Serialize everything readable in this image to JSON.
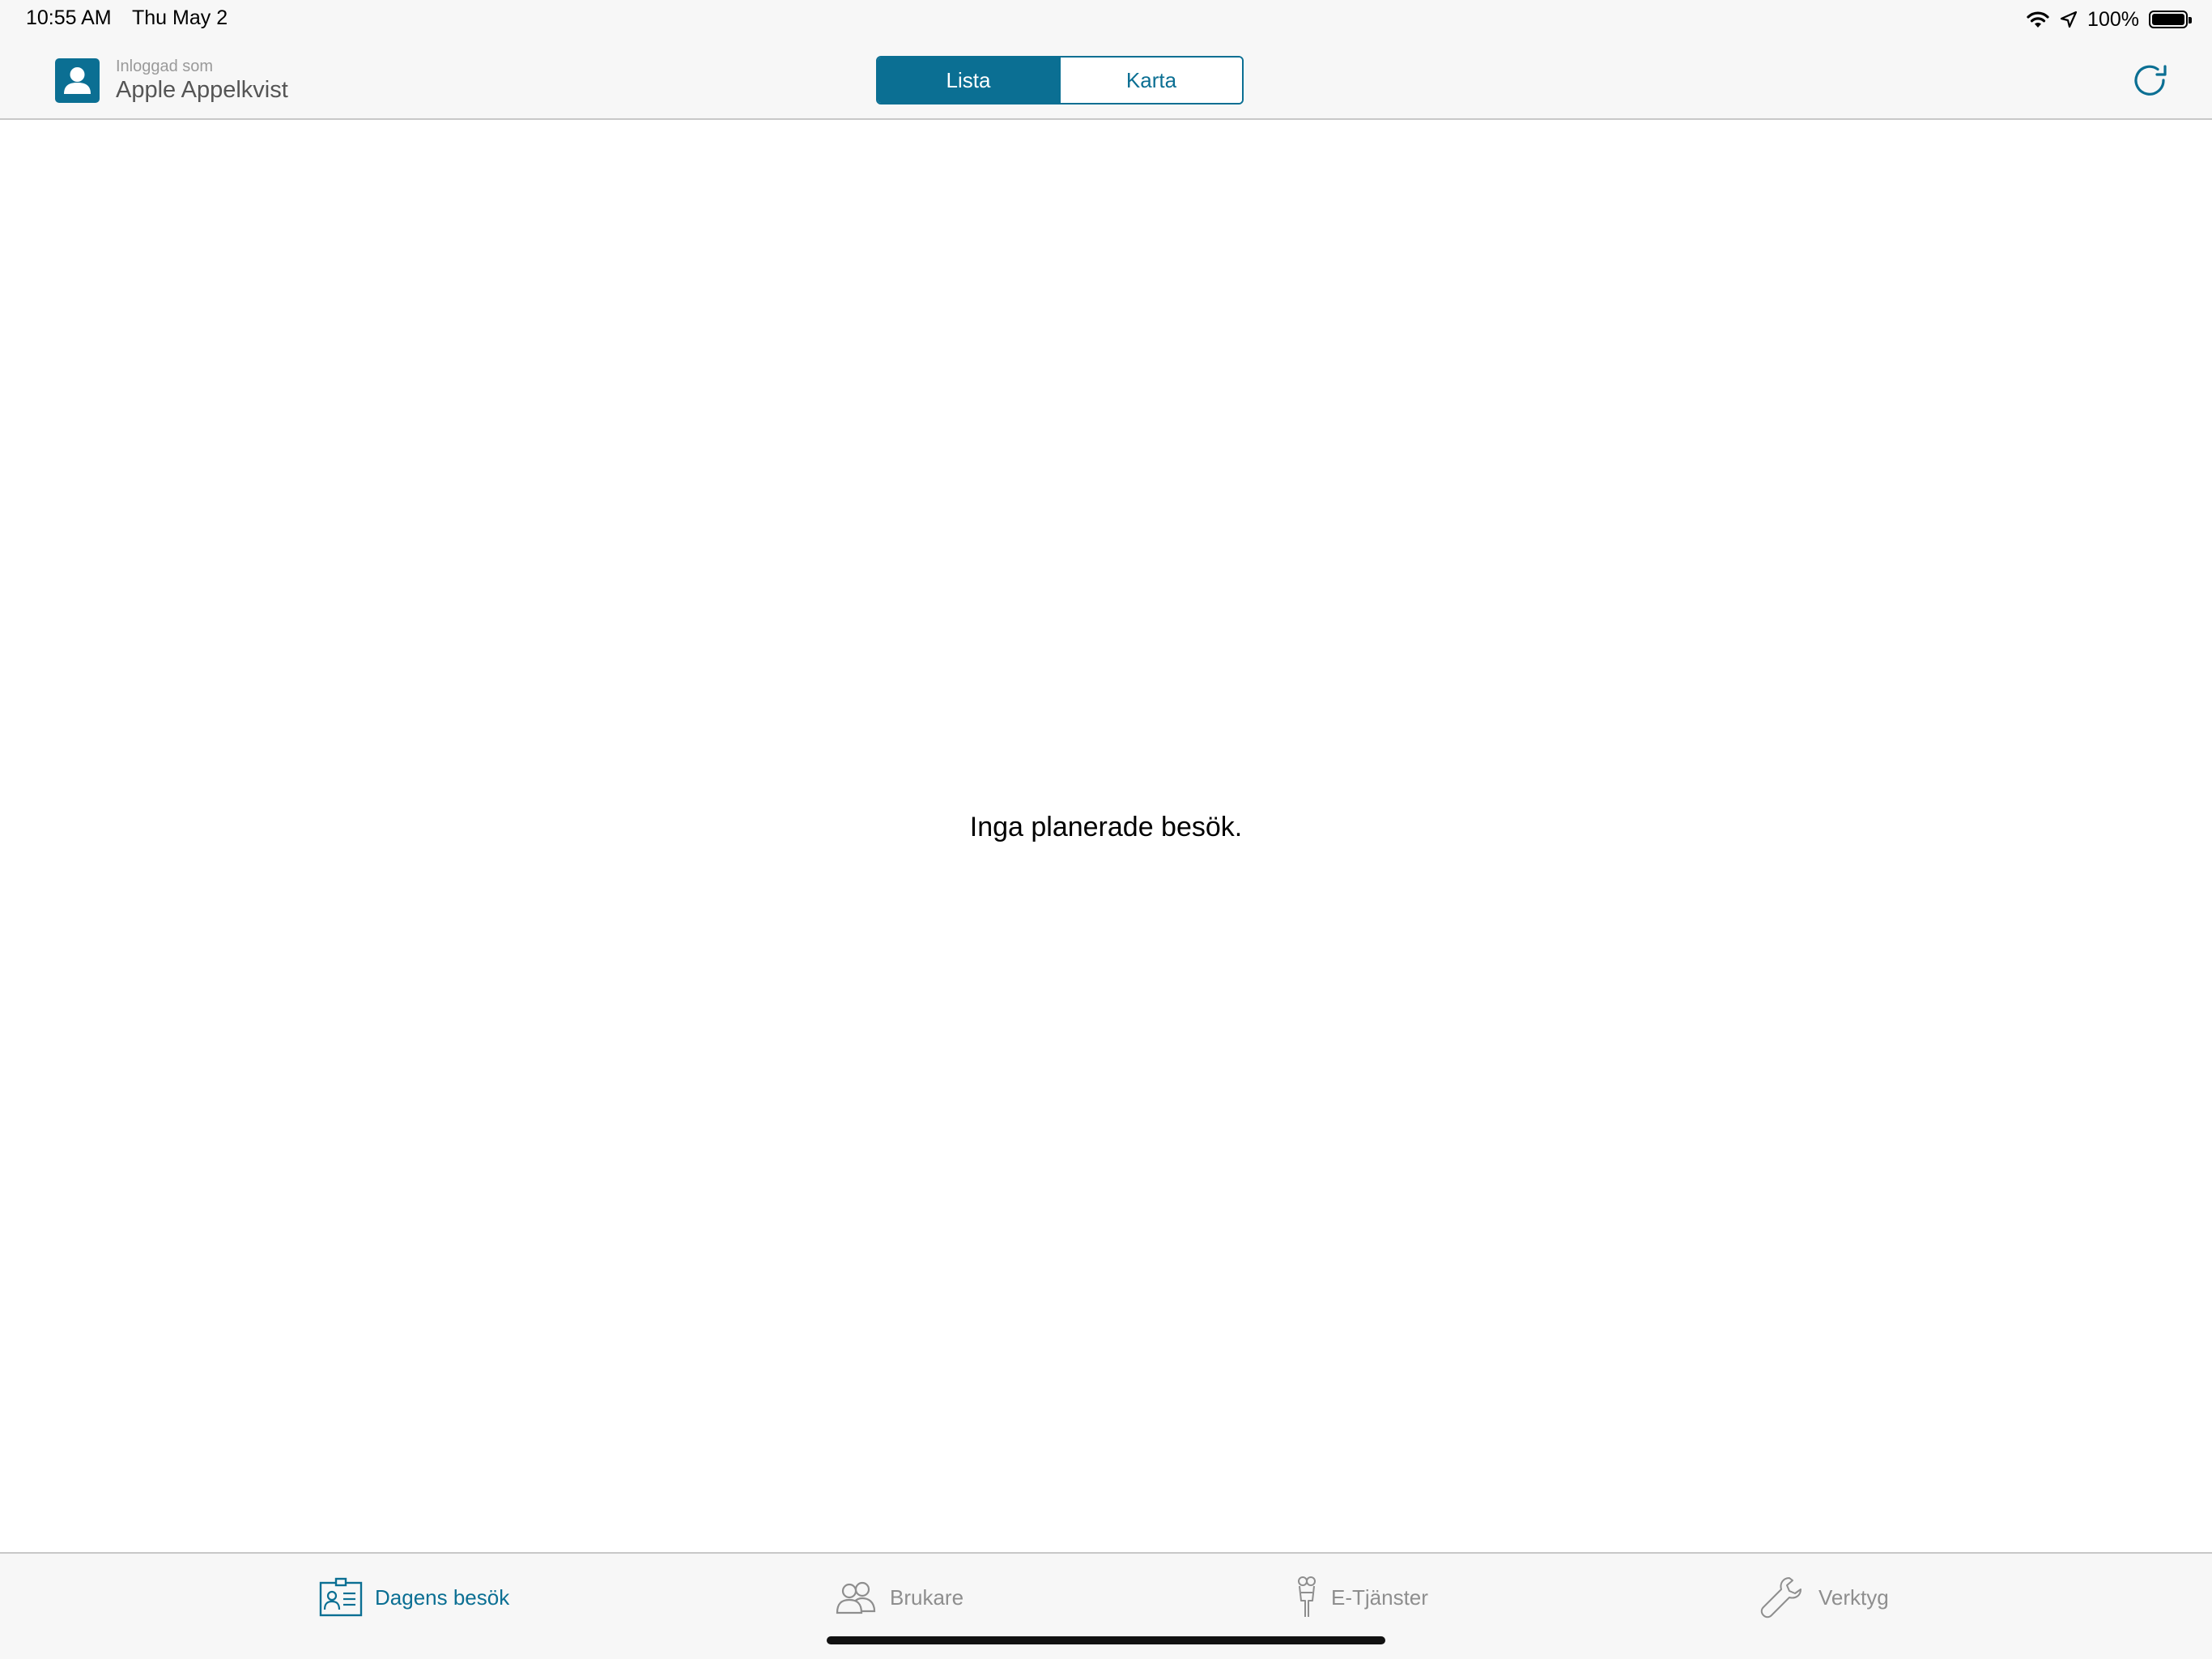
{
  "status_bar": {
    "time": "10:55 AM",
    "date": "Thu May 2",
    "battery": "100%",
    "battery_level": 1.0,
    "icons": [
      "wifi-icon",
      "location-arrow-icon",
      "battery-icon"
    ]
  },
  "header": {
    "user_caption": "Inloggad som",
    "user_name": "Apple Appelkvist",
    "segments": [
      {
        "label": "Lista",
        "selected": true
      },
      {
        "label": "Karta",
        "selected": false
      }
    ],
    "refresh_icon": "refresh-icon"
  },
  "main": {
    "empty_message": "Inga planerade besök."
  },
  "tabbar": {
    "items": [
      {
        "label": "Dagens besök",
        "icon": "visit-card-icon",
        "active": true
      },
      {
        "label": "Brukare",
        "icon": "users-icon",
        "active": false
      },
      {
        "label": "E-Tjänster",
        "icon": "e-services-icon",
        "active": false
      },
      {
        "label": "Verktyg",
        "icon": "wrench-icon",
        "active": false
      }
    ]
  },
  "colors": {
    "accent": "#0b6f93",
    "inactive": "#8e8e8e",
    "bar_background": "#f7f7f7"
  }
}
